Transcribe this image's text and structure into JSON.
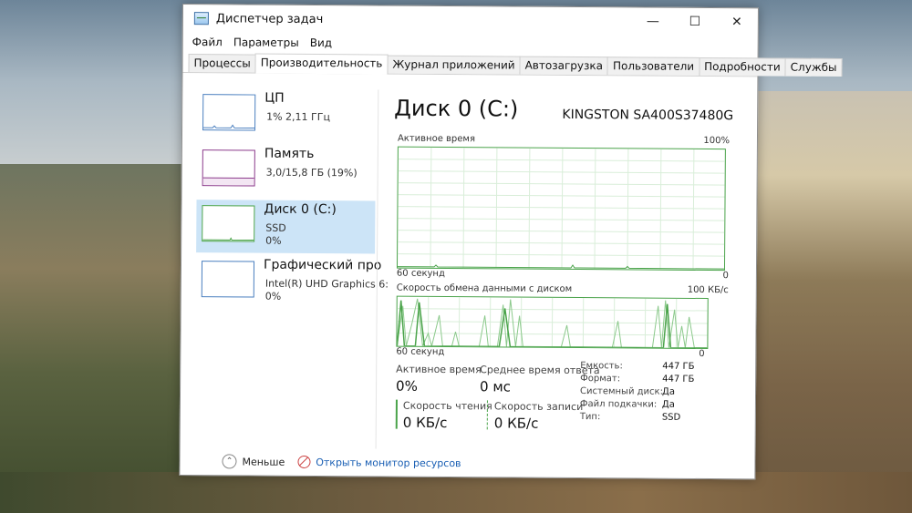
{
  "window": {
    "title": "Диспетчер задач"
  },
  "menu": [
    "Файл",
    "Параметры",
    "Вид"
  ],
  "tabs": [
    "Процессы",
    "Производительность",
    "Журнал приложений",
    "Автозагрузка",
    "Пользователи",
    "Подробности",
    "Службы"
  ],
  "active_tab": "Производительность",
  "sidebar": {
    "items": [
      {
        "title": "ЦП",
        "line1": "1% 2,11 ГГц",
        "line2": ""
      },
      {
        "title": "Память",
        "line1": "3,0/15,8 ГБ (19%)",
        "line2": ""
      },
      {
        "title": "Диск 0 (C:)",
        "line1": "SSD",
        "line2": "0%"
      },
      {
        "title": "Графический про",
        "line1": "Intel(R) UHD Graphics 6:",
        "line2": "0%"
      }
    ],
    "selected_index": 2
  },
  "main": {
    "title": "Диск 0 (C:)",
    "model": "KINGSTON SA400S37480G",
    "graph1": {
      "label": "Активное время",
      "max_label": "100%",
      "x_label": "60 секунд",
      "min_label": "0"
    },
    "graph2": {
      "label": "Скорость обмена данными с диском",
      "max_label": "100 КБ/с",
      "x_label": "60 секунд",
      "min_label": "0"
    },
    "stats": {
      "active_time_label": "Активное время",
      "active_time_value": "0%",
      "avg_response_label": "Среднее время ответа",
      "avg_response_value": "0 мс",
      "read_speed_label": "Скорость чтения",
      "read_speed_value": "0 КБ/с",
      "write_speed_label": "Скорость записи",
      "write_speed_value": "0 КБ/с"
    },
    "properties": [
      {
        "key": "Емкость:",
        "value": "447 ГБ"
      },
      {
        "key": "Формат:",
        "value": "447 ГБ"
      },
      {
        "key": "Системный диск:",
        "value": "Да"
      },
      {
        "key": "Файл подкачки:",
        "value": "Да"
      },
      {
        "key": "Тип:",
        "value": "SSD"
      }
    ]
  },
  "footer": {
    "fewer_label": "Меньше",
    "monitor_link": "Открыть монитор ресурсов"
  },
  "colors": {
    "disk_green": "#4aa34a",
    "selected_bg": "#cce4f7",
    "link": "#1a5fb4"
  },
  "icons": [
    "task-manager-icon",
    "minimize-icon",
    "maximize-icon",
    "close-icon",
    "chevron-up-icon",
    "resource-monitor-icon"
  ]
}
